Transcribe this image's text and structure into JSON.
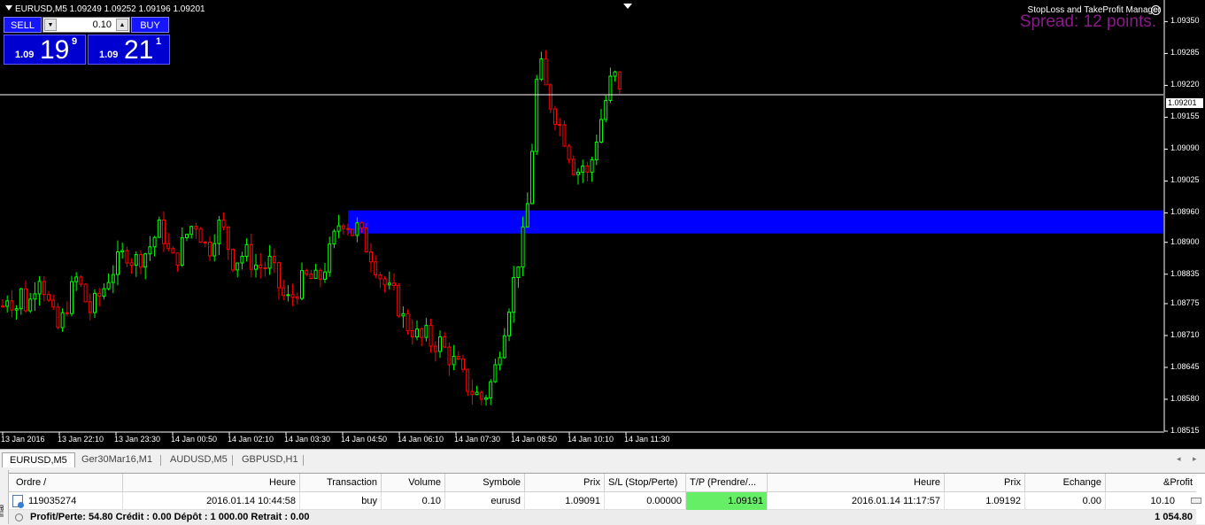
{
  "chart": {
    "symbol_line": "EURUSD,M5  1.09249 1.09252 1.09196 1.09201",
    "ea_title": "StopLoss and TakeProfit Manager",
    "spread_text": "Spread: 12 points.",
    "current_price_label": "1.09201",
    "price_labels": [
      "1.09350",
      "1.09285",
      "1.09220",
      "1.09155",
      "1.09090",
      "1.09025",
      "1.08960",
      "1.08900",
      "1.08835",
      "1.08775",
      "1.08710",
      "1.08645",
      "1.08580",
      "1.08515"
    ],
    "time_labels": [
      "13 Jan 2016",
      "13 Jan 22:10",
      "13 Jan 23:30",
      "14 Jan 00:50",
      "14 Jan 02:10",
      "14 Jan 03:30",
      "14 Jan 04:50",
      "14 Jan 06:10",
      "14 Jan 07:30",
      "14 Jan 08:50",
      "14 Jan 10:10",
      "14 Jan 11:30"
    ],
    "colors": {
      "background": "#000000",
      "bull": "#00ff00",
      "bear": "#ff0000",
      "zone": "#0000ff",
      "grid_line": "#ffffff"
    }
  },
  "chart_data": {
    "type": "candlestick",
    "symbol": "EURUSD",
    "timeframe": "M5",
    "ylim": [
      1.08515,
      1.09385
    ],
    "current_price": 1.09201,
    "zone": {
      "low": 1.08918,
      "high": 1.08965
    },
    "x": [
      "13 Jan 2016",
      "13 Jan 22:10",
      "13 Jan 23:30",
      "14 Jan 00:50",
      "14 Jan 02:10",
      "14 Jan 03:30",
      "14 Jan 04:50",
      "14 Jan 06:10",
      "14 Jan 07:30",
      "14 Jan 08:50",
      "14 Jan 10:10",
      "14 Jan 11:30"
    ],
    "close_path": [
      1.0877,
      1.088,
      1.0876,
      1.088,
      1.0876,
      1.0881,
      1.0884,
      1.0879,
      1.0875,
      1.0872,
      1.0876,
      1.088,
      1.0883,
      1.0879,
      1.0876,
      1.0878,
      1.088,
      1.0883,
      1.0885,
      1.0887,
      1.0888,
      1.0886,
      1.0887,
      1.0888,
      1.089,
      1.0893,
      1.0891,
      1.0886,
      1.0887,
      1.089,
      1.0893,
      1.0894,
      1.0891,
      1.0888,
      1.0892,
      1.0894,
      1.089,
      1.0886,
      1.0887,
      1.0888,
      1.0886,
      1.0885,
      1.0885,
      1.0886,
      1.0882,
      1.0879,
      1.0878,
      1.088,
      1.0882,
      1.0883,
      1.0882,
      1.0883,
      1.0886,
      1.089,
      1.0894,
      1.0895,
      1.0892,
      1.0893,
      1.089,
      1.0888,
      1.0885,
      1.0882,
      1.088,
      1.0879,
      1.0875,
      1.0873,
      1.0872,
      1.087,
      1.0871,
      1.0869,
      1.087,
      1.0868,
      1.0866,
      1.0865,
      1.0862,
      1.086,
      1.0859,
      1.0858,
      1.086,
      1.0864,
      1.087,
      1.0876,
      1.0882,
      1.0888,
      1.0894,
      1.091,
      1.0928,
      1.0922,
      1.0918,
      1.0915,
      1.0912,
      1.0908,
      1.0904,
      1.0906,
      1.0903,
      1.091,
      1.0915,
      1.092,
      1.0925,
      1.09201
    ]
  },
  "trade_panel": {
    "sell_label": "SELL",
    "buy_label": "BUY",
    "volume": "0.10",
    "sell_small": "1.09",
    "sell_big": "19",
    "sell_sup": "9",
    "buy_small": "1.09",
    "buy_big": "21",
    "buy_sup": "1",
    "arrow_down": "▼",
    "arrow_up": "▲"
  },
  "tabs": [
    "EURUSD,M5",
    "Ger30Mar16,M1",
    "AUDUSD,M5",
    "GBPUSD,H1"
  ],
  "terminal": {
    "side_label": "inal",
    "headers": [
      "Ordre  /",
      "Heure",
      "Transaction",
      "Volume",
      "Symbole",
      "Prix",
      "S/L (Stop/Perte)",
      "T/P (Prendre/...",
      "Heure",
      "Prix",
      "Echange",
      "&Profit"
    ],
    "rows": [
      [
        "119035274",
        "2016.01.14 10:44:58",
        "buy",
        "0.10",
        "eurusd",
        "1.09091",
        "0.00000",
        "1.09191",
        "2016.01.14 11:17:57",
        "1.09192",
        "0.00",
        "10.10"
      ]
    ],
    "summary": "Profit/Perte: 54.80  Crédit : 0.00  Dépôt : 1 000.00  Retrait : 0.00",
    "summary_total": "1 054.80"
  }
}
